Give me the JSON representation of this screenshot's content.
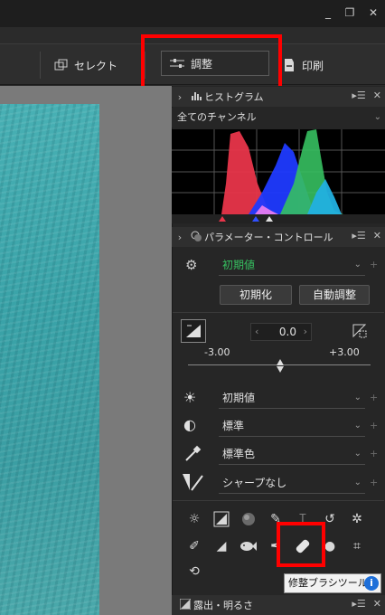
{
  "window": {
    "minimize": "_",
    "restore": "❐",
    "close": "✕"
  },
  "toolbar": {
    "select_label": "セレクト",
    "adjust_label": "調整",
    "print_label": "印刷"
  },
  "histogram": {
    "title": "ヒストグラム",
    "channel": "全てのチャンネル"
  },
  "param_control": {
    "title": "パラメーター・コントロール",
    "preset_value": "初期値",
    "reset_button": "初期化",
    "auto_button": "自動調整"
  },
  "exposure": {
    "value": "0.0",
    "min_label": "-3.00",
    "max_label": "+3.00"
  },
  "dropdowns": {
    "white_balance": "初期値",
    "picture_control": "標準",
    "color": "標準色",
    "sharpness": "シャープなし"
  },
  "tooltip": {
    "label": "修整ブラシツール",
    "info": "i"
  },
  "exposure_panel": {
    "title": "露出・明るさ"
  },
  "colors": {
    "accent_green": "#36c060",
    "highlight": "#ff0000"
  }
}
